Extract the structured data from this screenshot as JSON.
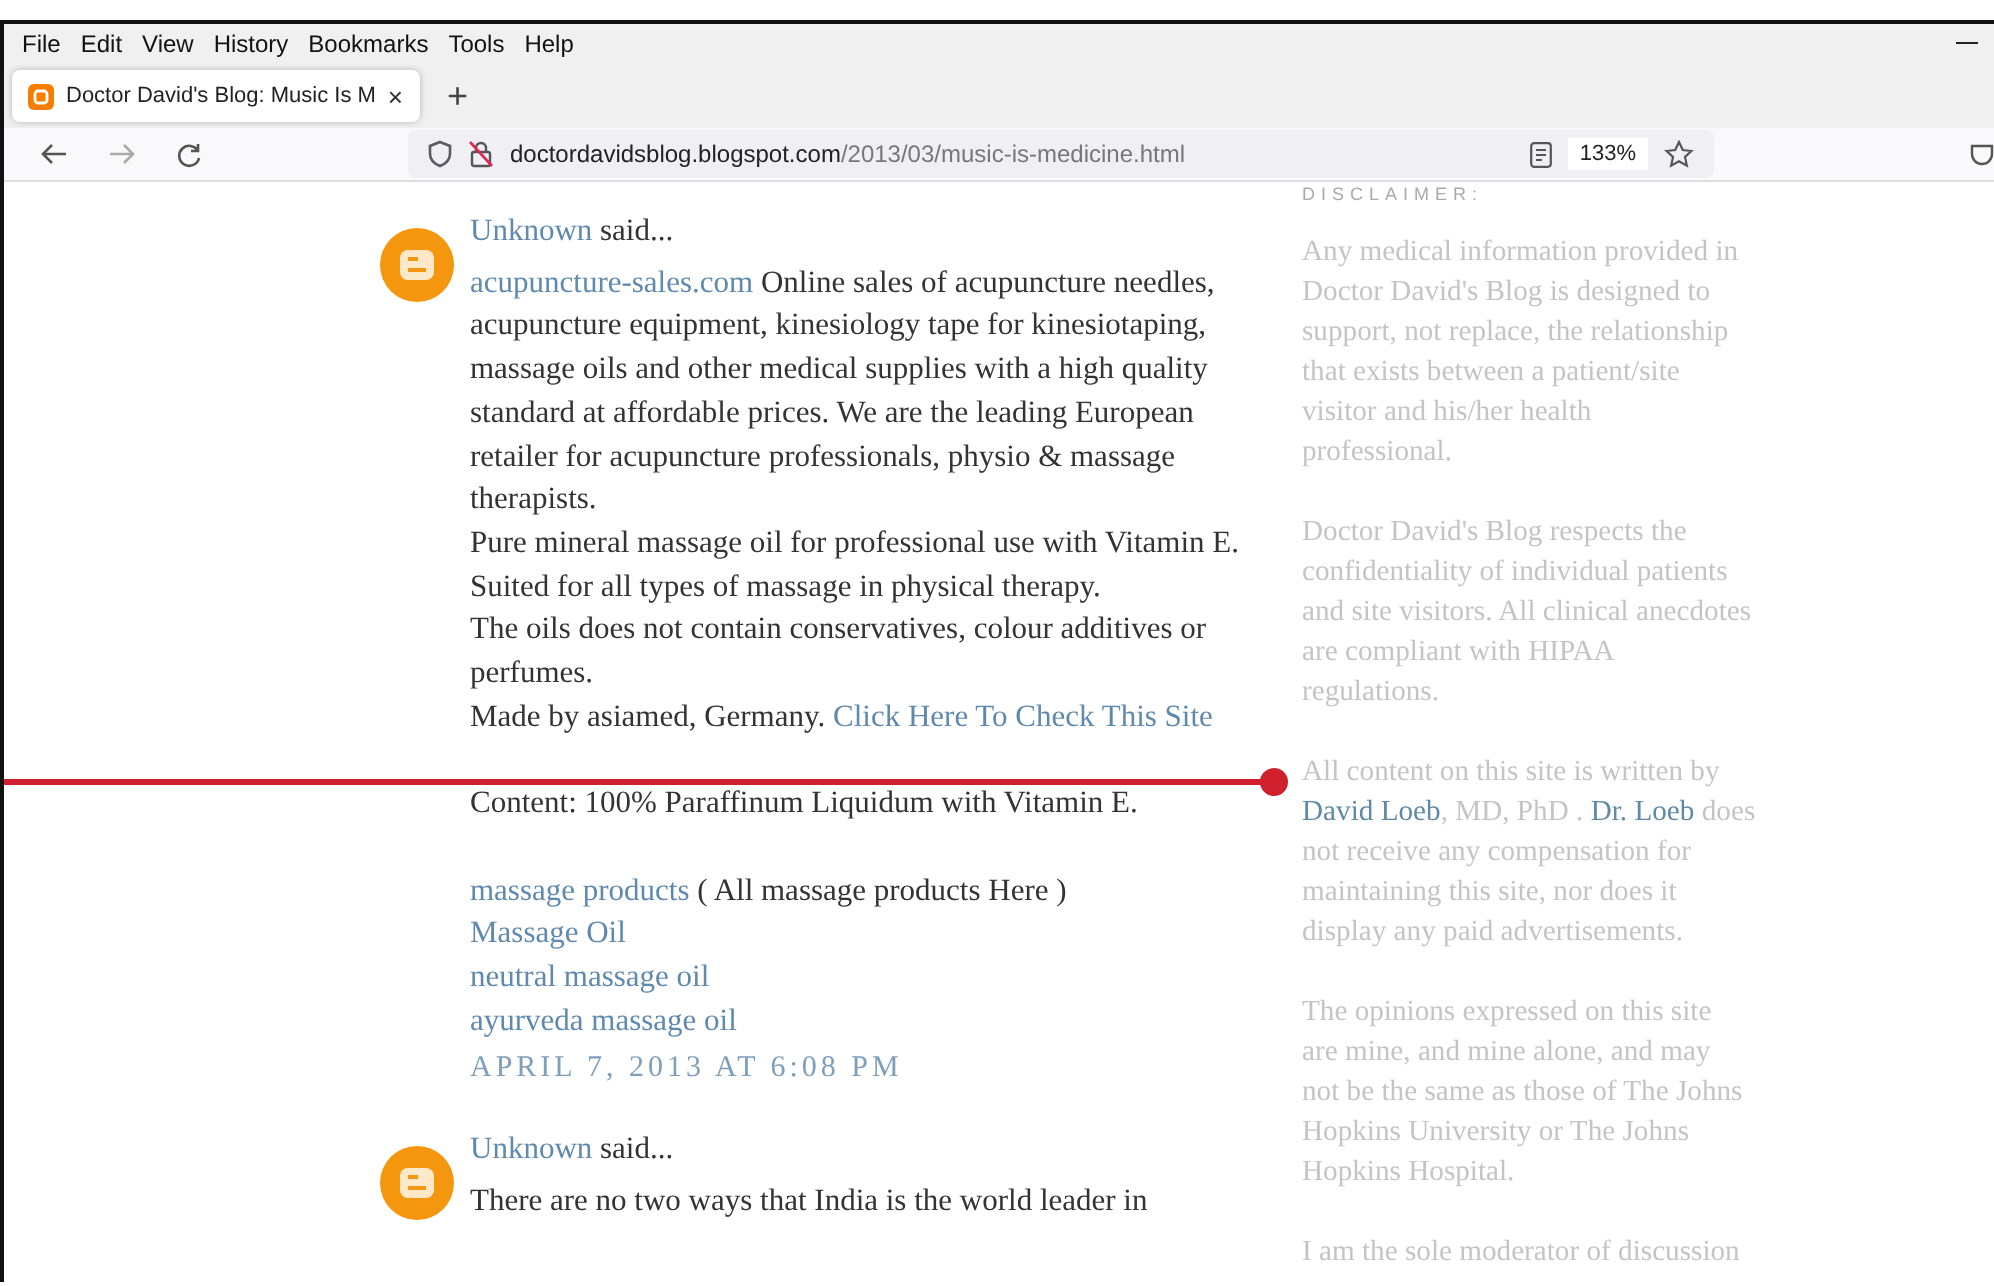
{
  "menu": [
    "File",
    "Edit",
    "View",
    "History",
    "Bookmarks",
    "Tools",
    "Help"
  ],
  "tabs": [
    {
      "title": "Doctor David's Blog: Music Is M",
      "close": "×",
      "selected": true
    }
  ],
  "new_tab": "+",
  "address": {
    "host": "doctordavidsblog.blogspot.com",
    "path": "/2013/03/music-is-medicine.html"
  },
  "zoom": "133%",
  "comments": [
    {
      "author": "Unknown",
      "said": "said...",
      "paragraphs": [
        [
          [
            {
              "kind": "link",
              "text": "acupuncture-sales.com"
            },
            {
              "kind": "text",
              "text": " Online sales of acupuncture needles,"
            }
          ],
          [
            {
              "kind": "text",
              "text": "acupuncture equipment, kinesiology tape for kinesiotaping,"
            }
          ],
          [
            {
              "kind": "text",
              "text": "massage oils and other medical supplies with a high quality"
            }
          ],
          [
            {
              "kind": "text",
              "text": "standard at affordable prices. We are the leading European"
            }
          ],
          [
            {
              "kind": "text",
              "text": "retailer for acupuncture professionals, physio & massage"
            }
          ],
          [
            {
              "kind": "text",
              "text": "therapists."
            }
          ],
          [
            {
              "kind": "text",
              "text": "Pure mineral massage oil for professional use with Vitamin E."
            }
          ],
          [
            {
              "kind": "text",
              "text": "Suited for all types of massage in physical therapy."
            }
          ],
          [
            {
              "kind": "text",
              "text": "The oils does not contain conservatives, colour additives or"
            }
          ],
          [
            {
              "kind": "text",
              "text": "perfumes."
            }
          ],
          [
            {
              "kind": "text",
              "text": "Made by asiamed, Germany. "
            },
            {
              "kind": "link",
              "text": "Click Here To Check This Site"
            }
          ]
        ],
        [
          [
            {
              "kind": "text",
              "text": "Content: 100% Paraffinum Liquidum with Vitamin E."
            }
          ]
        ],
        [
          [
            {
              "kind": "link",
              "text": "massage products"
            },
            {
              "kind": "text",
              "text": " ( All massage products Here )"
            }
          ],
          [
            {
              "kind": "link",
              "text": "Massage Oil"
            }
          ],
          [
            {
              "kind": "link",
              "text": "neutral massage oil"
            }
          ],
          [
            {
              "kind": "link",
              "text": "ayurveda massage oil"
            }
          ]
        ]
      ],
      "date": "APRIL 7, 2013 AT 6:08 PM"
    },
    {
      "author": "Unknown",
      "said": "said...",
      "paragraphs": [
        [
          [
            {
              "kind": "text",
              "text": "There are no two ways that India is the world leader in"
            }
          ]
        ]
      ]
    }
  ],
  "sidebar": {
    "heading": "DISCLAIMER:",
    "paragraphs": [
      [
        [
          {
            "kind": "text",
            "text": "Any medical information provided in"
          }
        ],
        [
          {
            "kind": "text",
            "text": "Doctor David's Blog is designed to"
          }
        ],
        [
          {
            "kind": "text",
            "text": "support, not replace, the relationship"
          }
        ],
        [
          {
            "kind": "text",
            "text": "that exists between a patient/site"
          }
        ],
        [
          {
            "kind": "text",
            "text": "visitor and his/her health"
          }
        ],
        [
          {
            "kind": "text",
            "text": "professional."
          }
        ]
      ],
      [
        [
          {
            "kind": "text",
            "text": "Doctor David's Blog respects the"
          }
        ],
        [
          {
            "kind": "text",
            "text": "confidentiality of individual patients"
          }
        ],
        [
          {
            "kind": "text",
            "text": "and site visitors. All clinical anecdotes"
          }
        ],
        [
          {
            "kind": "text",
            "text": "are compliant with HIPAA"
          }
        ],
        [
          {
            "kind": "text",
            "text": "regulations."
          }
        ]
      ],
      [
        [
          {
            "kind": "text",
            "text": "All content on this site is written by"
          }
        ],
        [
          {
            "kind": "link",
            "text": "David Loeb"
          },
          {
            "kind": "text",
            "text": ", MD, PhD . "
          },
          {
            "kind": "link",
            "text": "Dr. Loeb"
          },
          {
            "kind": "text",
            "text": " does"
          }
        ],
        [
          {
            "kind": "text",
            "text": "not receive any compensation for"
          }
        ],
        [
          {
            "kind": "text",
            "text": "maintaining this site, nor does it"
          }
        ],
        [
          {
            "kind": "text",
            "text": "display any paid advertisements."
          }
        ]
      ],
      [
        [
          {
            "kind": "text",
            "text": "The opinions expressed on this site"
          }
        ],
        [
          {
            "kind": "text",
            "text": "are mine, and mine alone, and may"
          }
        ],
        [
          {
            "kind": "text",
            "text": "not be the same as those of The Johns"
          }
        ],
        [
          {
            "kind": "text",
            "text": "Hopkins University or The Johns"
          }
        ],
        [
          {
            "kind": "text",
            "text": "Hopkins Hospital."
          }
        ]
      ],
      [
        [
          {
            "kind": "text",
            "text": "I am the sole moderator of discussion"
          }
        ]
      ]
    ]
  }
}
